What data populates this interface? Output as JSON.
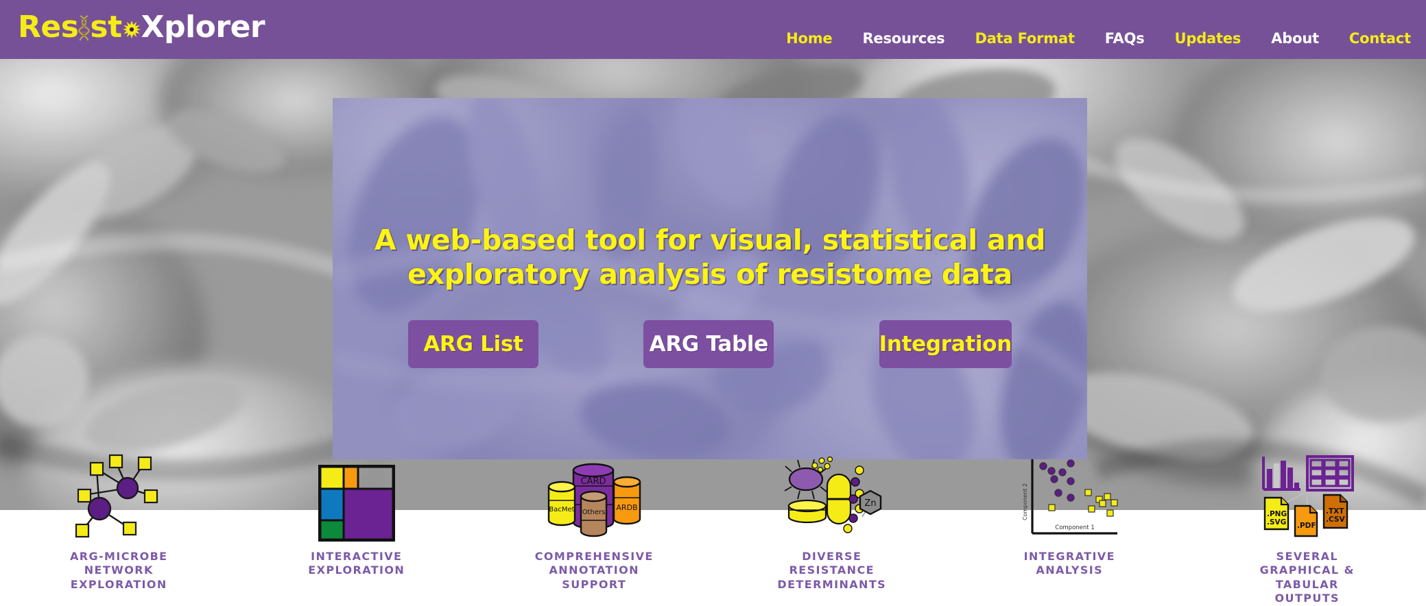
{
  "brand": {
    "part1": "Res",
    "helix_icon": "dna-helix-icon",
    "part2": "st",
    "burst_icon": "starburst-icon",
    "part3": "Xplorer",
    "full_text": "ResistoXplorer"
  },
  "nav": {
    "items": [
      {
        "label": "Home",
        "color": "#f5ec17"
      },
      {
        "label": "Resources",
        "color": "#ffffff"
      },
      {
        "label": "Data Format",
        "color": "#f5ec17"
      },
      {
        "label": "FAQs",
        "color": "#ffffff"
      },
      {
        "label": "Updates",
        "color": "#f5ec17"
      },
      {
        "label": "About",
        "color": "#ffffff"
      },
      {
        "label": "Contact",
        "color": "#f5ec17"
      }
    ]
  },
  "hero": {
    "title": "A web-based tool for visual, statistical and exploratory analysis of resistome data",
    "buttons": [
      {
        "label": "ARG List",
        "text_color": "#fbf414"
      },
      {
        "label": "ARG Table",
        "text_color": "#ffffff"
      },
      {
        "label": "Integration",
        "text_color": "#fbf414"
      }
    ]
  },
  "features": [
    {
      "icon": "arg-microbe-network-icon",
      "label": "ARG-Microbe\nNetwork\nExploration"
    },
    {
      "icon": "treemap-icon",
      "label": "Interactive\nExploration"
    },
    {
      "icon": "databases-icon",
      "label": "Comprehensive\nAnnotation\nSupport"
    },
    {
      "icon": "resistance-determinants-icon",
      "label": "Diverse\nResistance\nDeterminants"
    },
    {
      "icon": "scatter-plot-icon",
      "label": "Integrative\nAnalysis"
    },
    {
      "icon": "outputs-icon",
      "label": "Several\nGraphical &\nTabular\nOutputs"
    }
  ],
  "feature_icon_text": {
    "databases": [
      "CARD",
      "BacMet",
      "Others",
      "ARDB"
    ],
    "determinants": [
      "Zn"
    ],
    "scatter_axes": {
      "x": "Component 1",
      "y": "Component 2"
    },
    "outputs_files": [
      ".PNG\n.SVG",
      ".PDF",
      ".TXT\n.CSV"
    ]
  },
  "colors": {
    "brand_purple": "#775198",
    "accent_yellow": "#f5ec17",
    "button_purple": "#7d4fa0",
    "label_purple": "#7d5aa8",
    "hero_tint": "rgba(125,124,180,0.55)"
  }
}
